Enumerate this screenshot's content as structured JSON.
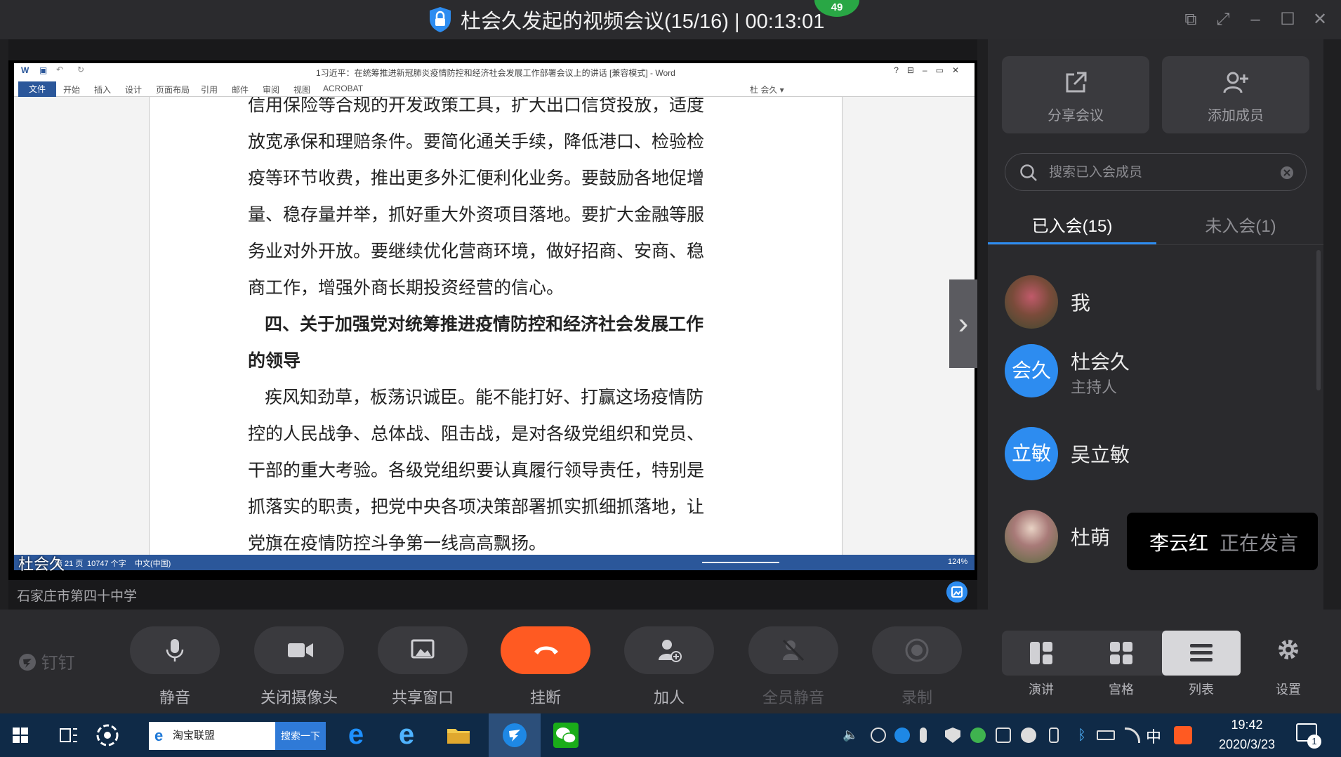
{
  "window": {
    "title": "杜会久发起的视频会议(15/16) | 00:13:01",
    "network_badge": "49"
  },
  "word": {
    "title": "1习近平：在统筹推进新冠肺炎疫情防控和经济社会发展工作部署会议上的讲话 [兼容模式] - Word",
    "tabs": [
      "文件",
      "开始",
      "插入",
      "设计",
      "页面布局",
      "引用",
      "邮件",
      "审阅",
      "视图",
      "ACROBAT"
    ],
    "user": "杜 会久 ▾",
    "paragraphs": [
      "信用保险等合规的开发政策工具，扩大出口信贷投放，适度",
      "放宽承保和理赔条件。要简化通关手续，降低港口、检验检",
      "疫等环节收费，推出更多外汇便利化业务。要鼓励各地促增",
      "量、稳存量并举，抓好重大外资项目落地。要扩大金融等服",
      "务业对外开放。要继续优化营商环境，做好招商、安商、稳",
      "商工作，增强外商长期投资经营的信心。",
      "四、关于加强党对统筹推进疫情防控和经济社会发展工作",
      "的领导",
      "疾风知劲草，板荡识诚臣。能不能打好、打赢这场疫情防",
      "控的人民战争、总体战、阻击战，是对各级党组织和党员、",
      "干部的重大考验。各级党组织要认真履行领导责任，特别是",
      "抓落实的职责，把党中央各项决策部署抓实抓细抓落地，让",
      "党旗在疫情防控斗争第一线高高飘扬。"
    ],
    "status": {
      "page": "第 21 页",
      "words": "10747 个字",
      "lang": "中文(中国)",
      "zoom": "124%"
    }
  },
  "share": {
    "speaker": "杜会久",
    "source": "石家庄市第四十中学"
  },
  "sidebar": {
    "share_label": "分享会议",
    "add_label": "添加成员",
    "search_placeholder": "搜索已入会成员",
    "tab_joined": "已入会(15)",
    "tab_not_joined": "未入会(1)",
    "members": [
      {
        "name": "我",
        "avatar": "",
        "role": ""
      },
      {
        "name": "杜会久",
        "avatar": "会久",
        "role": "主持人"
      },
      {
        "name": "吴立敏",
        "avatar": "立敏",
        "role": ""
      },
      {
        "name": "杜萌",
        "avatar": "",
        "role": ""
      }
    ],
    "speaking_name": "李云红",
    "speaking_status": "正在发言"
  },
  "toolbar": {
    "brand": "钉钉",
    "mute": "静音",
    "camera": "关闭摄像头",
    "share_window": "共享窗口",
    "hangup": "挂断",
    "add_person": "加人",
    "mute_all": "全员静音",
    "record": "录制",
    "view_speaker": "演讲",
    "view_grid": "宫格",
    "view_list": "列表",
    "settings": "设置"
  },
  "taskbar": {
    "search_text": "淘宝联盟",
    "search_button": "搜索一下",
    "ime": "中",
    "time": "19:42",
    "date": "2020/3/23",
    "notification_count": "1"
  },
  "colors": {
    "accent": "#2d8cf0",
    "hangup": "#ff5a22",
    "word_blue": "#2b579a"
  }
}
